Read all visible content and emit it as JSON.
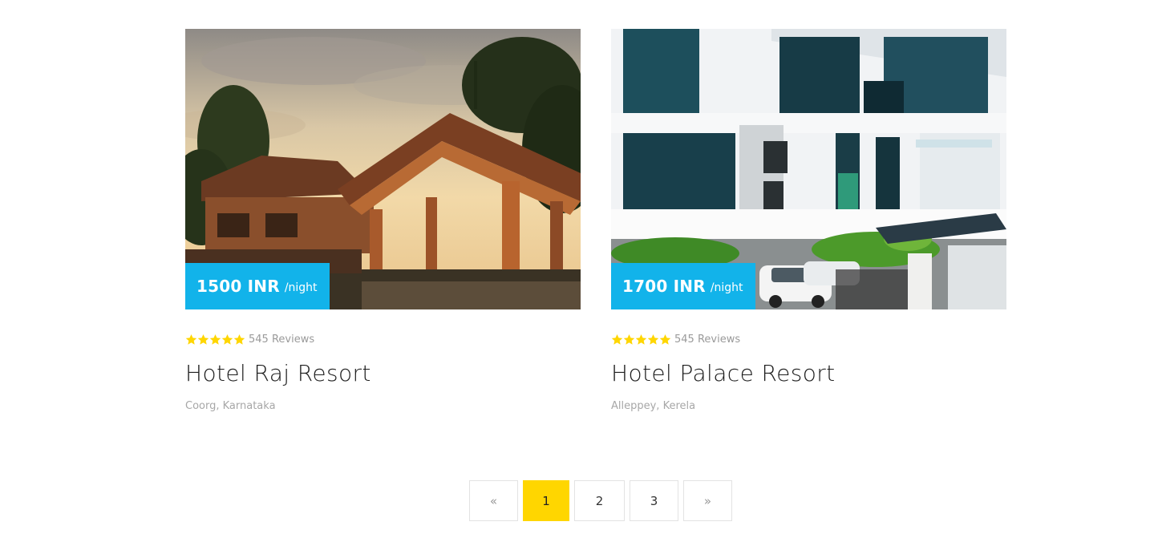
{
  "colors": {
    "price_badge": "#12b3ea",
    "star": "#ffd600",
    "active_page": "#ffd600"
  },
  "hotels": [
    {
      "price": "1500 INR",
      "unit": "/night",
      "rating": 5,
      "reviews": "545 Reviews",
      "name": "Hotel Raj Resort",
      "location": "Coorg, Karnataka",
      "image_icon": "resort-photo"
    },
    {
      "price": "1700 INR",
      "unit": "/night",
      "rating": 5,
      "reviews": "545 Reviews",
      "name": "Hotel Palace Resort",
      "location": "Alleppey, Kerela",
      "image_icon": "hotel-building-photo"
    }
  ],
  "pagination": {
    "prev": "«",
    "pages": [
      "1",
      "2",
      "3"
    ],
    "next": "»",
    "current": "1"
  }
}
